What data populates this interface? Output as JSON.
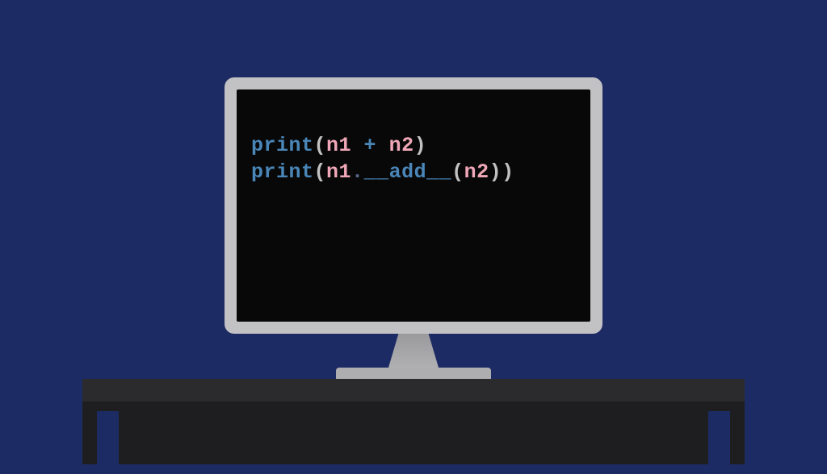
{
  "code": {
    "line1": {
      "func": "print",
      "open": "(",
      "var1": "n1",
      "op": " + ",
      "var2": "n2",
      "close": ")"
    },
    "line2": {
      "func": "print",
      "open": "(",
      "var1": "n1",
      "dot": ".",
      "method": "__add__",
      "open2": "(",
      "var2": "n2",
      "close2": ")",
      "close": ")"
    }
  }
}
